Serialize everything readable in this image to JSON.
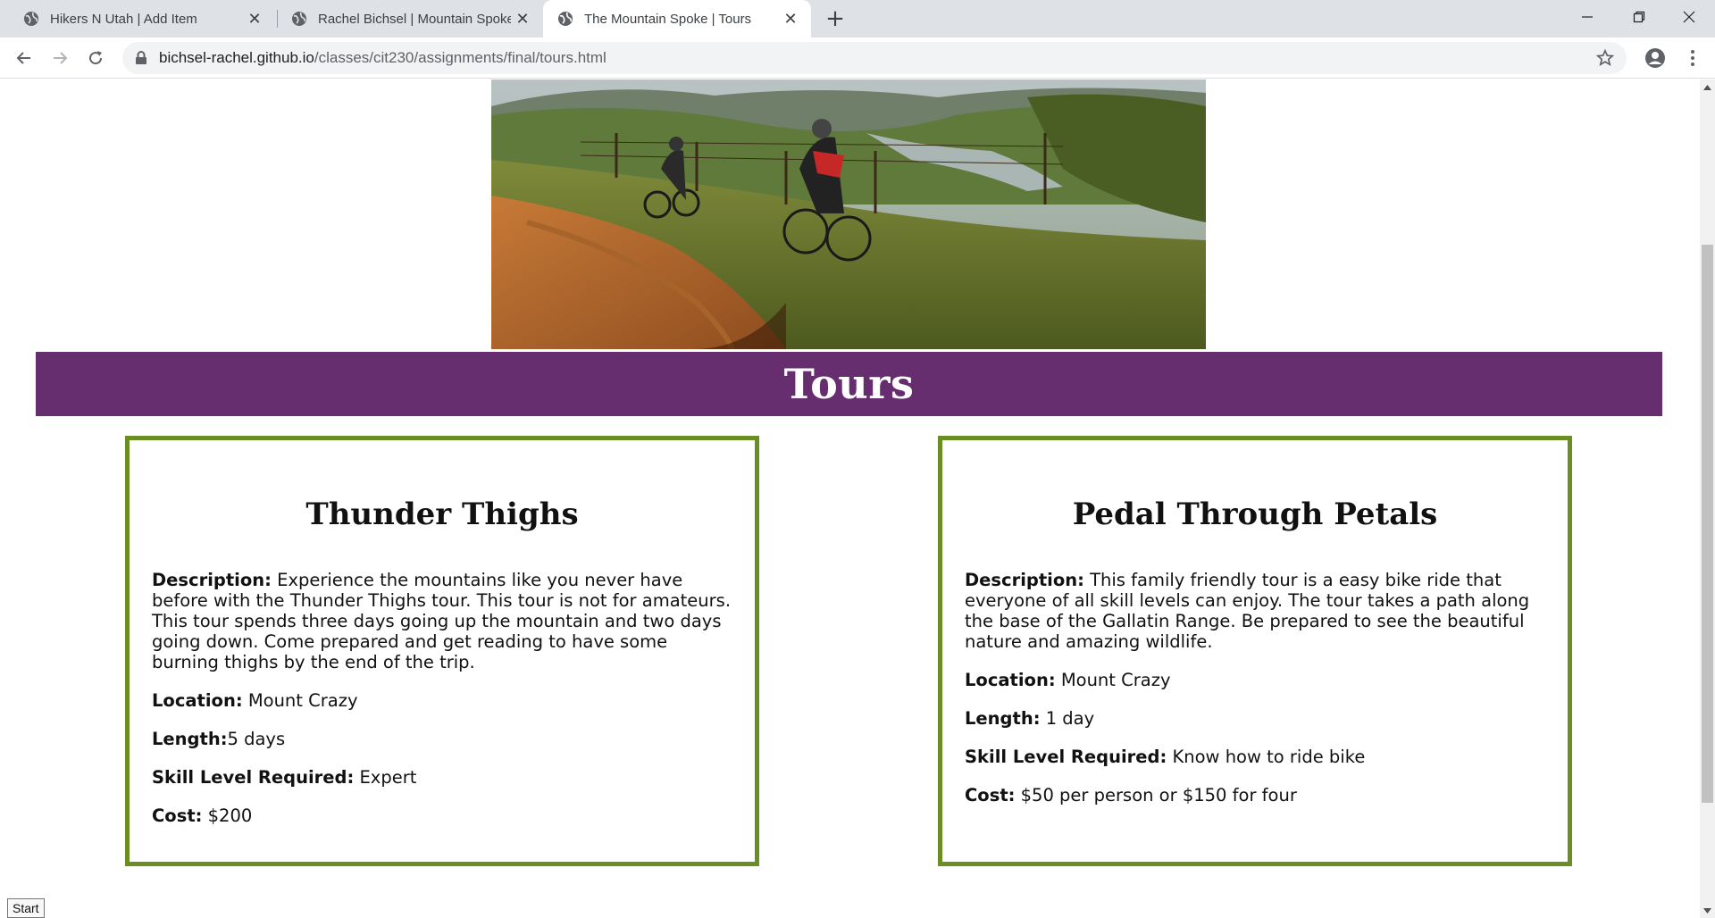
{
  "browser": {
    "tabs": [
      {
        "title": "Hikers N Utah | Add Item",
        "close": "✕"
      },
      {
        "title": "Rachel Bichsel | Mountain Spoke",
        "close": "✕"
      },
      {
        "title": "The Mountain Spoke | Tours",
        "close": "✕",
        "active": true
      }
    ],
    "new_tab": "+",
    "window_controls": {
      "minimize": "—",
      "restore": "❐",
      "close": "✕"
    },
    "url_host": "bichsel-rachel.github.io",
    "url_path": "/classes/cit230/assignments/final/tours.html"
  },
  "page": {
    "heading": "Tours",
    "tours": [
      {
        "name": "Thunder Thighs",
        "description_label": "Description:",
        "description": " Experience the mountains like you never have before with the Thunder Thighs tour. This tour is not for amateurs. This tour spends three days going up the mountain and two days going down. Come prepared and get reading to have some burning thighs by the end of the trip.",
        "location_label": "Location:",
        "location": " Mount Crazy",
        "length_label": "Length:",
        "length": "5 days",
        "skill_label": "Skill Level Required:",
        "skill": " Expert",
        "cost_label": "Cost:",
        "cost": " $200"
      },
      {
        "name": "Pedal Through Petals",
        "description_label": "Description:",
        "description": " This family friendly tour is a easy bike ride that everyone of all skill levels can enjoy. The tour takes a path along the base of the Gallatin Range. Be prepared to see the beautiful nature and amazing wildlife.",
        "location_label": "Location:",
        "location": " Mount Crazy",
        "length_label": "Length:",
        "length": " 1 day",
        "skill_label": "Skill Level Required:",
        "skill": " Know how to ride bike",
        "cost_label": "Cost:",
        "cost": " $50 per person or $150 for four"
      }
    ],
    "start_button": "Start"
  },
  "colors": {
    "banner": "#662d6f",
    "card_border": "#6b8e23",
    "tabstrip": "#dee1e6"
  },
  "icons": [
    "globe-icon",
    "close-icon",
    "back-arrow-icon",
    "forward-arrow-icon",
    "reload-icon",
    "lock-icon",
    "star-icon",
    "profile-icon",
    "menu-dots-icon"
  ]
}
